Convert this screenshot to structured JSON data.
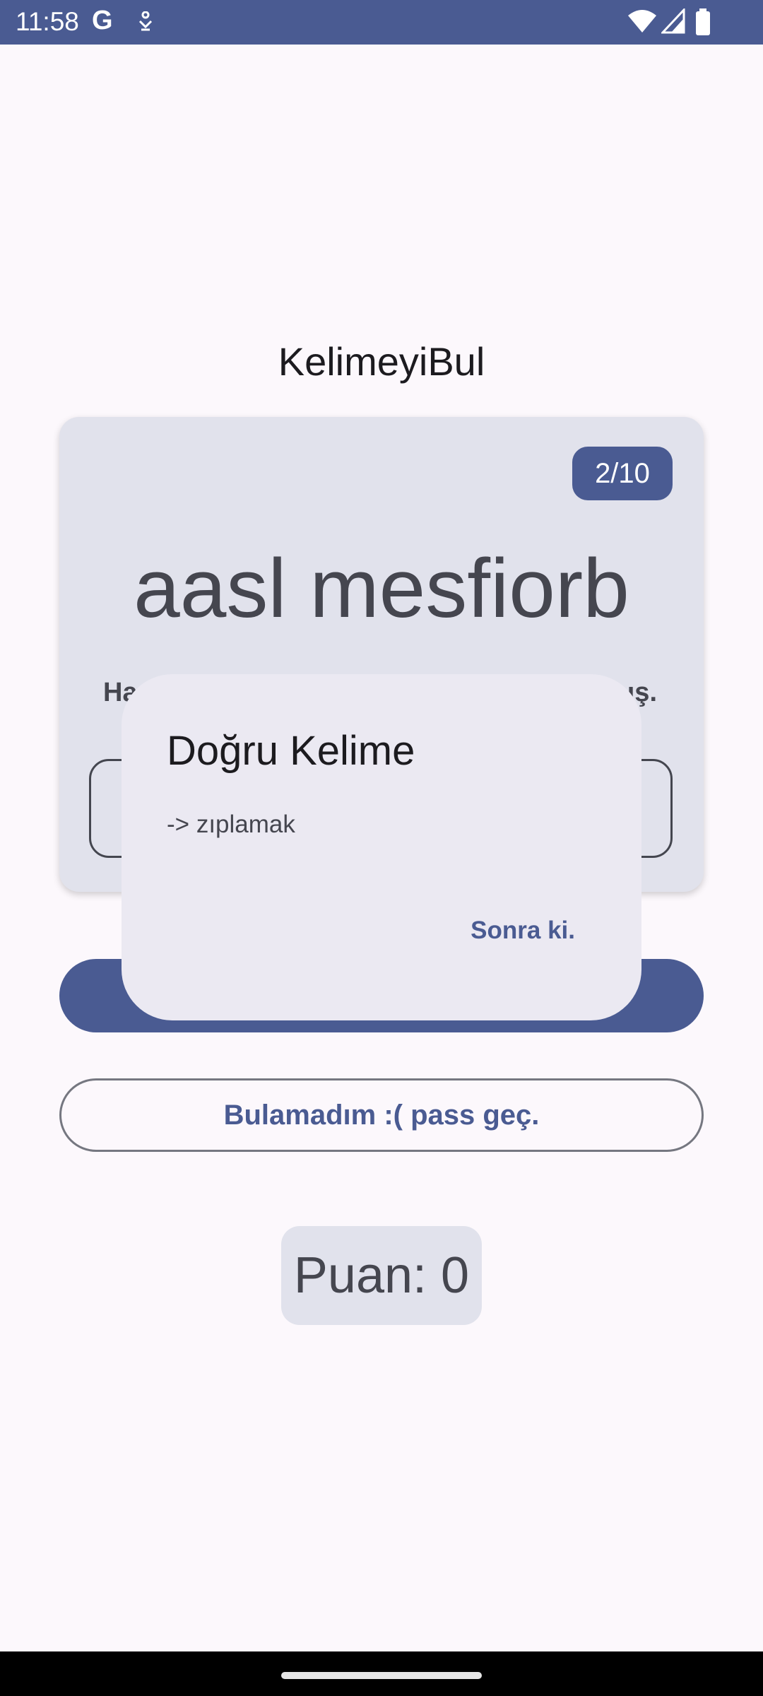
{
  "status_bar": {
    "time": "11:58",
    "google_letter": "G",
    "icons": [
      "google-icon",
      "notification-icon",
      "wifi-icon",
      "signal-icon",
      "battery-icon"
    ]
  },
  "app": {
    "title": "KelimeyiBul",
    "counter": "2/10",
    "scrambled_word": "aasl mesfiorb",
    "hint_start": "Ha",
    "hint_end": "ış.",
    "skip_button": "Bulamadım :( pass geç.",
    "score": "Puan: 0"
  },
  "dialog": {
    "title": "Doğru Kelime",
    "body": "-> zıplamak",
    "action": "Sonra ki."
  },
  "colors": {
    "primary": "#4a5b92",
    "card": "#e1e2ec",
    "dialog": "#ebe9f2",
    "background": "#fcf8fc"
  }
}
